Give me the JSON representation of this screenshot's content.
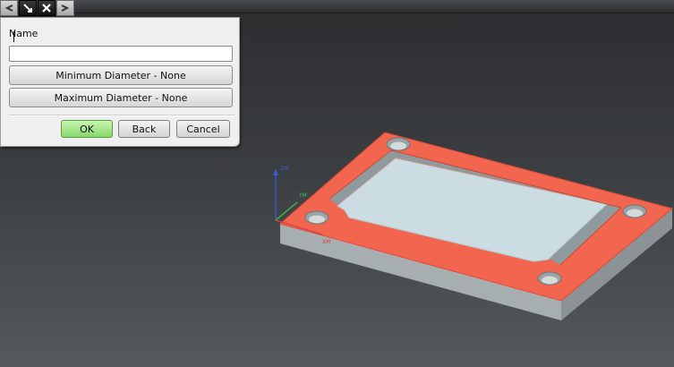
{
  "toolbar": {
    "icons": [
      "back-arrow-icon",
      "pin-icon",
      "close-icon",
      "forward-arrow-icon"
    ]
  },
  "dialog": {
    "name_label": "Name",
    "name_value": "",
    "min_diameter_label": "Minimum Diameter - None",
    "max_diameter_label": "Maximum Diameter - None",
    "ok_label": "OK",
    "back_label": "Back",
    "cancel_label": "Cancel"
  },
  "viewport": {
    "axis_z_label": "ZM",
    "axis_y_label": "YM",
    "axis_x_label": "XM",
    "colors": {
      "highlight_face": "#f2664f",
      "pocket_floor": "#c9dbe0",
      "block_side": "#9ea5a7",
      "axis_z": "#3a5bd8",
      "axis_y": "#3ec24a",
      "axis_x": "#d84040"
    }
  }
}
